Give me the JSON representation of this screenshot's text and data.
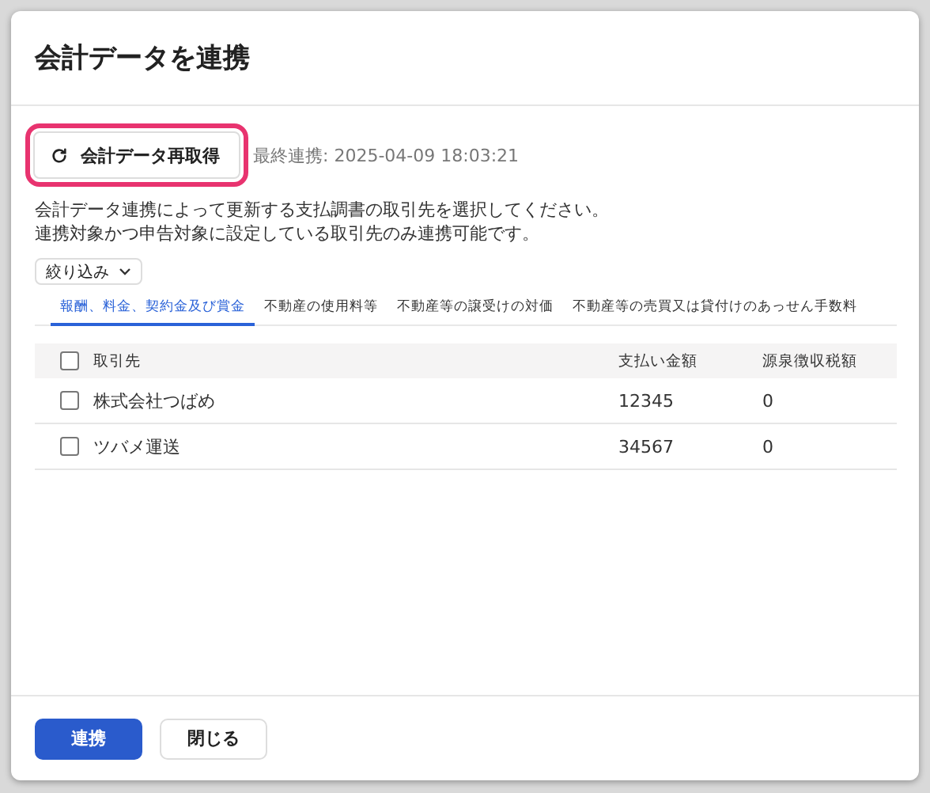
{
  "dialog": {
    "title": "会計データを連携"
  },
  "refresh_button": {
    "label": "会計データ再取得",
    "highlighted": true
  },
  "last_sync": "最終連携: 2025-04-09 18:03:21",
  "description": [
    "会計データ連携によって更新する支払調書の取引先を選択してください。",
    "連携対象かつ申告対象に設定している取引先のみ連携可能です。"
  ],
  "filter": {
    "label": "絞り込み"
  },
  "tabs": [
    {
      "label": "報酬、料金、契約金及び賞金",
      "selected": true
    },
    {
      "label": "不動産の使用料等",
      "selected": false
    },
    {
      "label": "不動産等の譲受けの対価",
      "selected": false
    },
    {
      "label": "不動産等の売買又は貸付けのあっせん手数料",
      "selected": false
    }
  ],
  "table": {
    "select_all_checked": false,
    "columns": [
      "取引先",
      "支払い金額",
      "源泉徴収税額"
    ],
    "rows": [
      {
        "checked": false,
        "cells": [
          "株式会社つばめ",
          "12345",
          "0"
        ]
      },
      {
        "checked": false,
        "cells": [
          "ツバメ運送",
          "34567",
          "0"
        ]
      }
    ]
  },
  "buttons": [
    {
      "label": "連携",
      "kind": "primary"
    },
    {
      "label": "閉じる",
      "kind": "secondary"
    }
  ]
}
